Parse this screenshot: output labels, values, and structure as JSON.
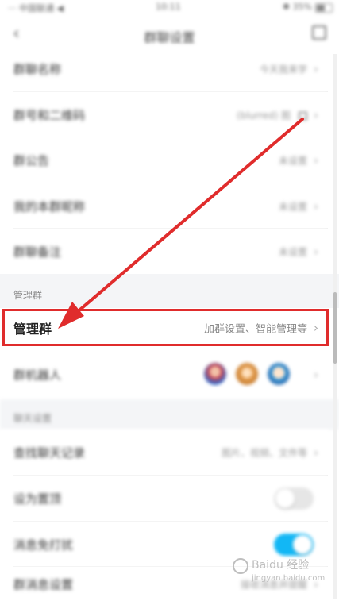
{
  "status_bar": {
    "left": "··· 中国联通 ◀",
    "time": "10:11",
    "right": "✱ 35%"
  },
  "nav": {
    "title": "群聊设置"
  },
  "rows_top": [
    {
      "label": "群聊名称",
      "value": "今天我来学"
    },
    {
      "label": "群号和二维码",
      "value": "(blurred) 图"
    },
    {
      "label": "群公告",
      "value": "未设置"
    },
    {
      "label": "我的本群昵称",
      "value": "未设置"
    },
    {
      "label": "群聊备注",
      "value": "未设置"
    }
  ],
  "section_manage": {
    "title": "管理群"
  },
  "manage_row": {
    "label": "管理群",
    "value": "加群设置、智能管理等"
  },
  "robot_row": {
    "label": "群机器人"
  },
  "section_other": {
    "title": "聊天设置"
  },
  "rows_bottom": [
    {
      "label": "查找聊天记录",
      "value": "图片、视频、文件等"
    },
    {
      "label": "设为置顶",
      "toggle": false
    },
    {
      "label": "消息免打扰",
      "toggle": true
    },
    {
      "label": "群消息设置",
      "value": "接收消息并提醒"
    }
  ],
  "watermark": {
    "text": "Baidu 经验",
    "sub": "jingyan.baidu.com"
  },
  "colors": {
    "accent_red": "#e02c2c",
    "toggle_on": "#12b7f5",
    "toggle_off": "#e6e6e6"
  }
}
